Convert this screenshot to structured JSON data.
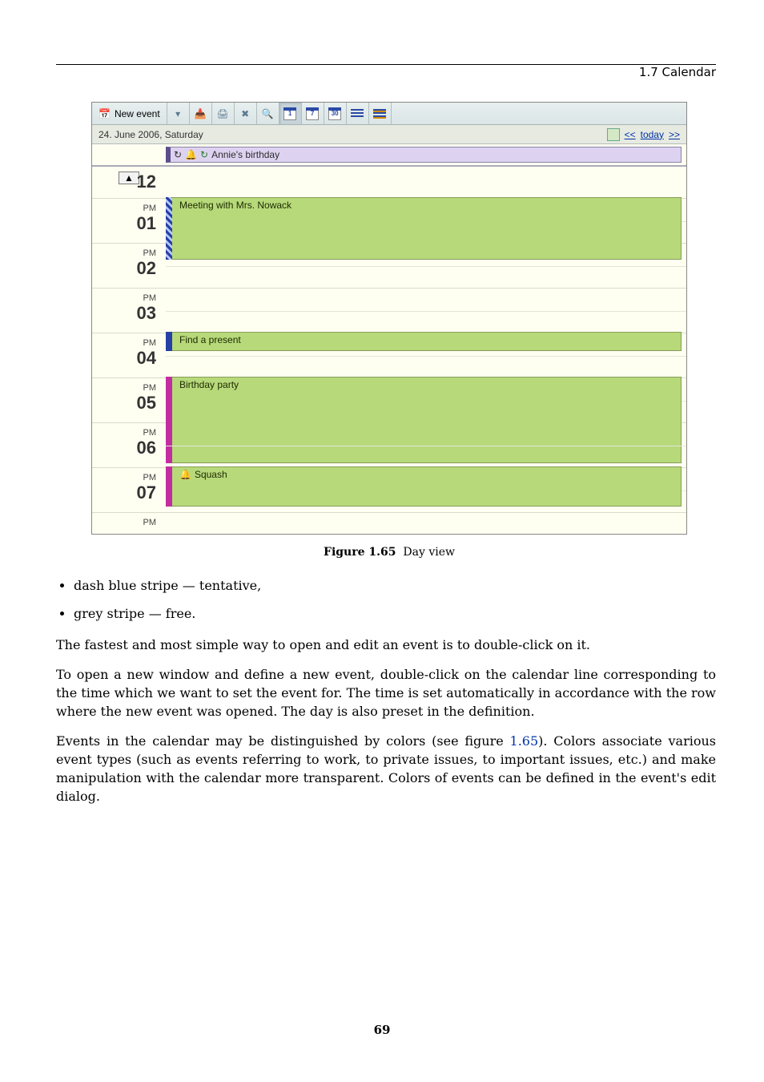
{
  "header": {
    "section": "1.7 Calendar"
  },
  "toolbar": {
    "new_event": "New event",
    "view_day": "1",
    "view_week": "7",
    "view_month": "30"
  },
  "datebar": {
    "date": "24. June 2006, Saturday",
    "prev": "<<",
    "today": "today",
    "next": ">>"
  },
  "allday": {
    "title": "Annie's birthday"
  },
  "hours": {
    "h12": "12",
    "h01": "01",
    "h02": "02",
    "h03": "03",
    "h04": "04",
    "h05": "05",
    "h06": "06",
    "h07": "07",
    "pm": "PM"
  },
  "events": {
    "meeting": "Meeting with Mrs. Nowack",
    "present": "Find a present",
    "party": "Birthday party",
    "squash": "Squash"
  },
  "caption": {
    "label": "Figure 1.65",
    "text": "Day view"
  },
  "bullets": {
    "b1": "dash blue stripe — tentative,",
    "b2": "grey stripe — free."
  },
  "para": {
    "p1": "The fastest and most simple way to open and edit an event is to double-click on it.",
    "p2": "To open a new window and define a new event, double-click on the calendar line corresponding to the time which we want to set the event for. The time is set automatically in accordance with the row where the new event was opened. The day is also preset in the definition.",
    "p3a": "Events in the calendar may be distinguished by colors (see figure ",
    "p3link": "1.65",
    "p3b": "). Colors associate various event types (such as events referring to work, to private issues, to important issues, etc.) and make manipulation with the calendar more transparent. Colors of events can be defined in the event's edit dialog."
  },
  "pagenum": "69"
}
